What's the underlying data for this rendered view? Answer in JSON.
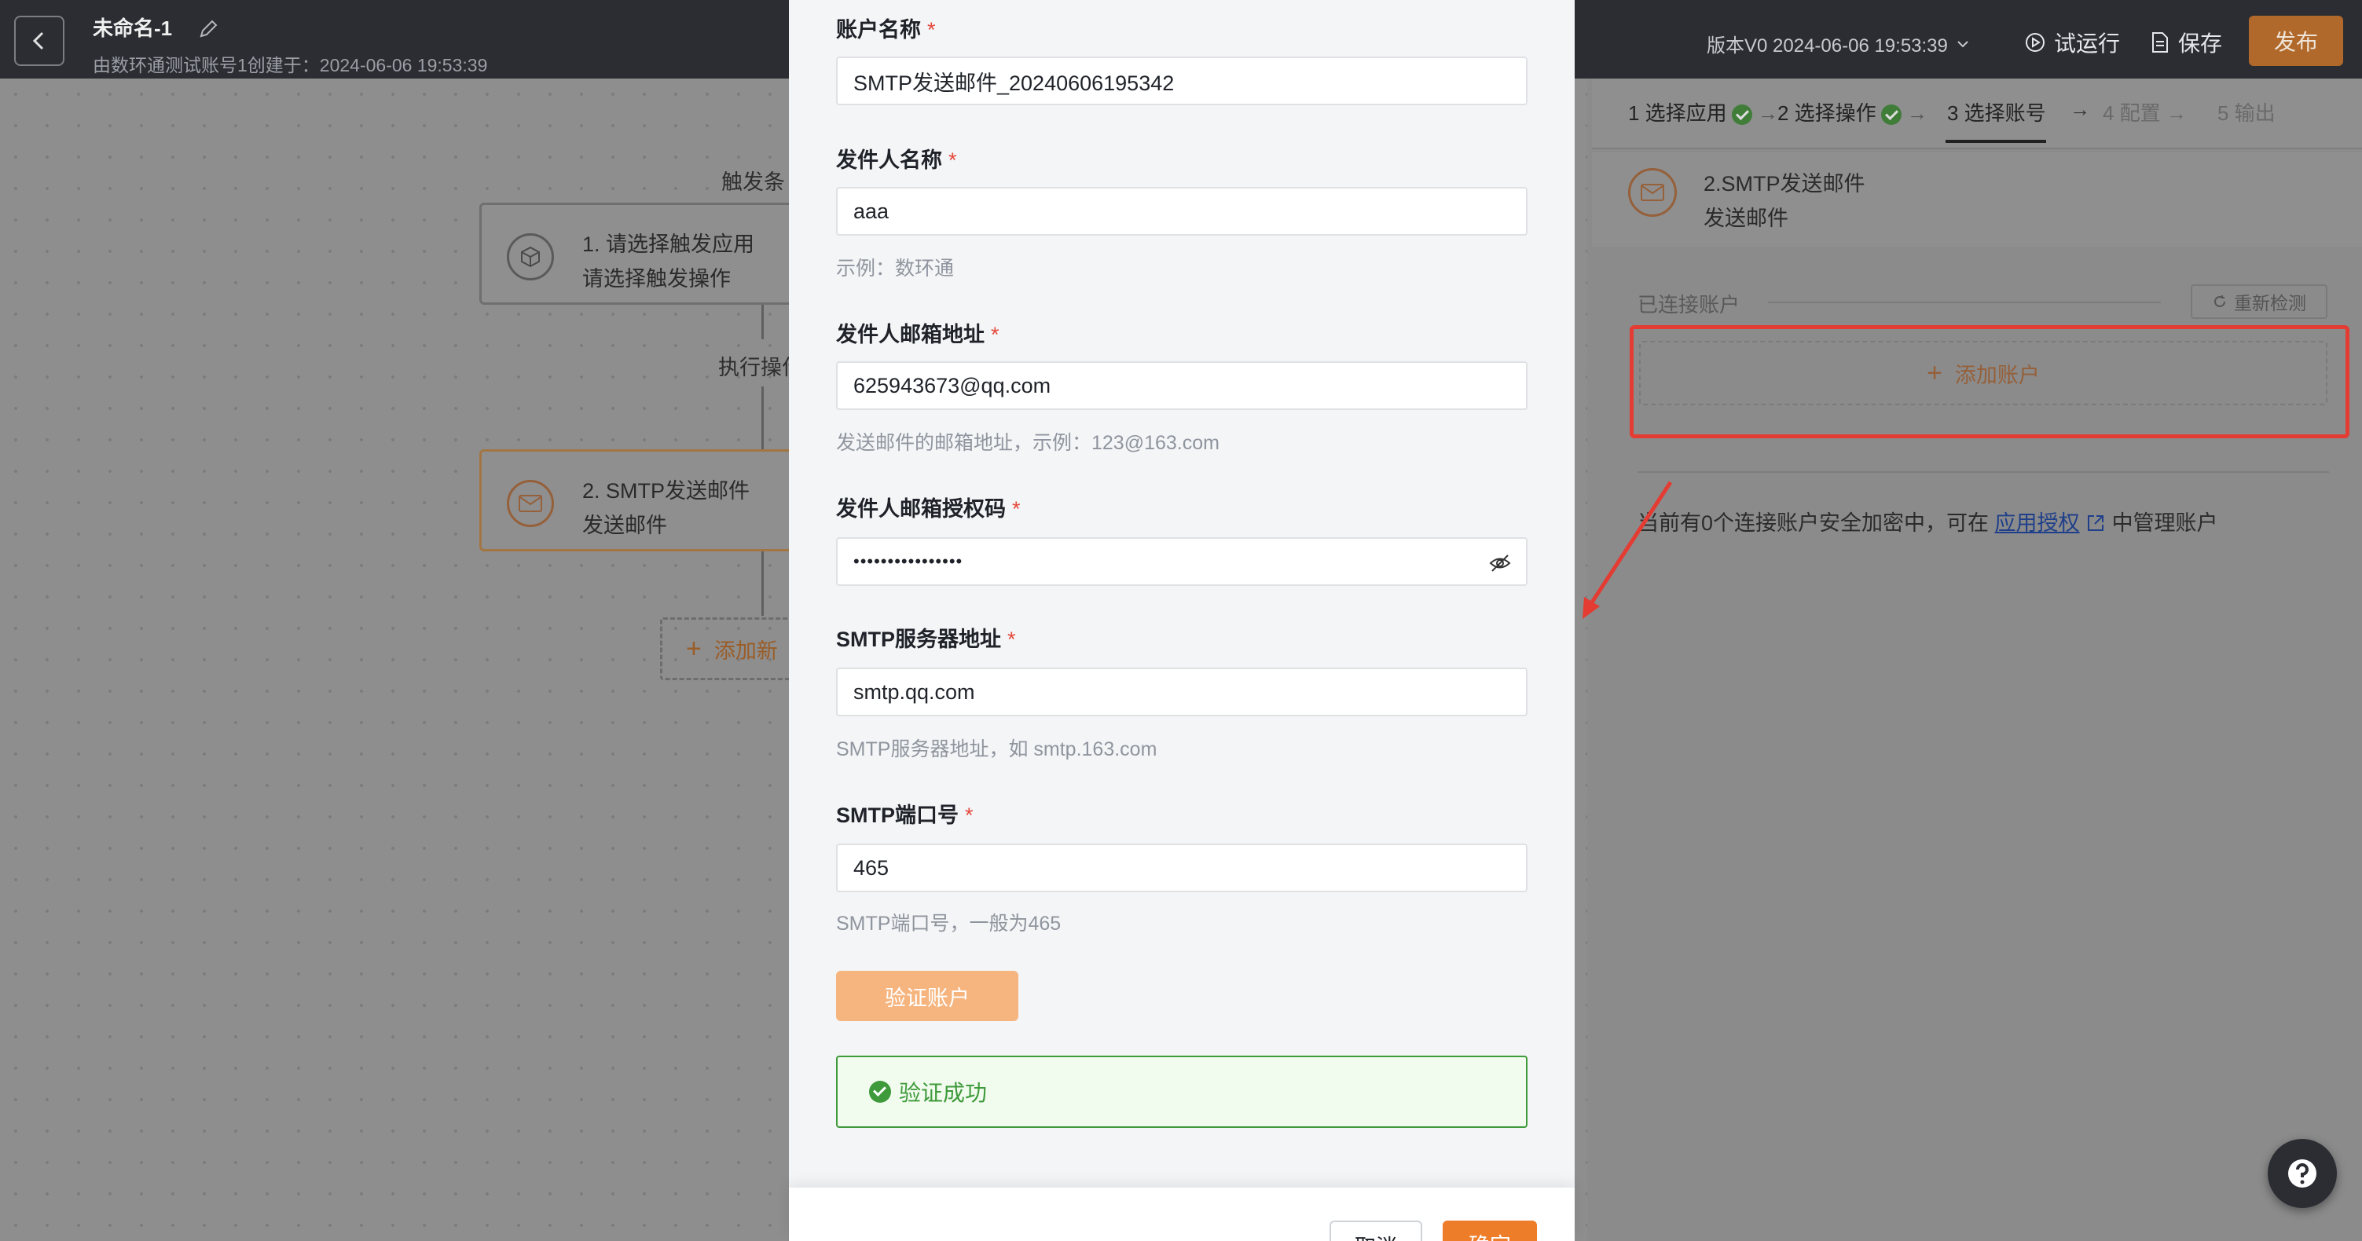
{
  "header": {
    "title": "未命名-1",
    "subtitle": "由数环通测试账号1创建于：2024-06-06 19:53:39",
    "version": "版本V0 2024-06-06 19:53:39",
    "trial_label": "试运行",
    "save_label": "保存",
    "publish_label": "发布"
  },
  "canvas": {
    "trigger_label": "触发条",
    "action_label": "执行操作",
    "node1": {
      "title": "1. 请选择触发应用",
      "subtitle": "请选择触发操作"
    },
    "node2": {
      "title": "2. SMTP发送邮件",
      "subtitle": "发送邮件"
    },
    "add_node_label": "添加新"
  },
  "right_panel": {
    "steps": [
      "1 选择应用",
      "2 选择操作",
      "3 选择账号",
      "4 配置",
      "5 输出"
    ],
    "card_title": "2.SMTP发送邮件",
    "card_subtitle": "发送邮件",
    "connected_label": "已连接账户",
    "recheck_label": "重新检测",
    "add_account_label": "添加账户",
    "info_prefix": "当前有0个连接账户安全加密中，可在",
    "info_link": "应用授权",
    "info_suffix": "中管理账户"
  },
  "modal": {
    "account_name": {
      "label": "账户名称",
      "value": "SMTP发送邮件_20240606195342"
    },
    "sender_name": {
      "label": "发件人名称",
      "value": "aaa",
      "hint": "示例：数环通"
    },
    "sender_email": {
      "label": "发件人邮箱地址",
      "value": "625943673@qq.com",
      "hint": "发送邮件的邮箱地址，示例：123@163.com"
    },
    "auth_code": {
      "label": "发件人邮箱授权码",
      "value": "••••••••••••••••"
    },
    "smtp_server": {
      "label": "SMTP服务器地址",
      "value": "smtp.qq.com",
      "hint": "SMTP服务器地址，如 smtp.163.com"
    },
    "smtp_port": {
      "label": "SMTP端口号",
      "value": "465",
      "hint": "SMTP端口号，一般为465"
    },
    "required_mark": "*",
    "verify_label": "验证账户",
    "success_label": "验证成功",
    "cancel_label": "取消",
    "ok_label": "确定"
  },
  "colors": {
    "accent": "#ee7d2a",
    "success": "#3e9a3a",
    "highlight": "#e43b32",
    "link": "#1f3f8a"
  }
}
